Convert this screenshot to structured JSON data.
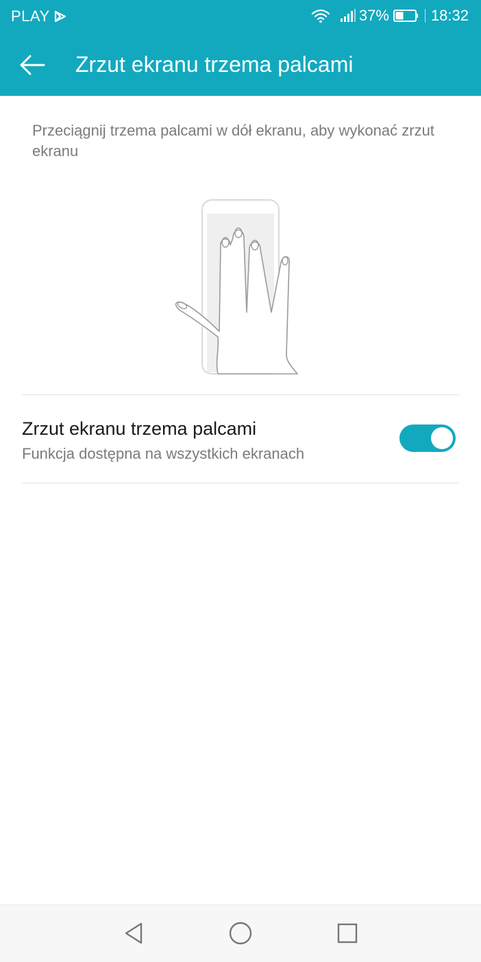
{
  "status_bar": {
    "carrier": "PLAY",
    "battery": "37%",
    "time": "18:32"
  },
  "app_bar": {
    "title": "Zrzut ekranu trzema palcami"
  },
  "description": "Przeciągnij trzema palcami w dół ekranu, aby wykonać zrzut ekranu",
  "setting": {
    "title": "Zrzut ekranu trzema palcami",
    "subtitle": "Funkcja dostępna na wszystkich ekranach",
    "enabled": true
  },
  "colors": {
    "accent": "#12a9bf",
    "text_primary": "#1a1a1a",
    "text_secondary": "#7b7b7b"
  },
  "icons": {
    "back": "arrow-left-icon",
    "nav_back": "triangle-back-icon",
    "nav_home": "circle-home-icon",
    "nav_recents": "square-recents-icon"
  }
}
